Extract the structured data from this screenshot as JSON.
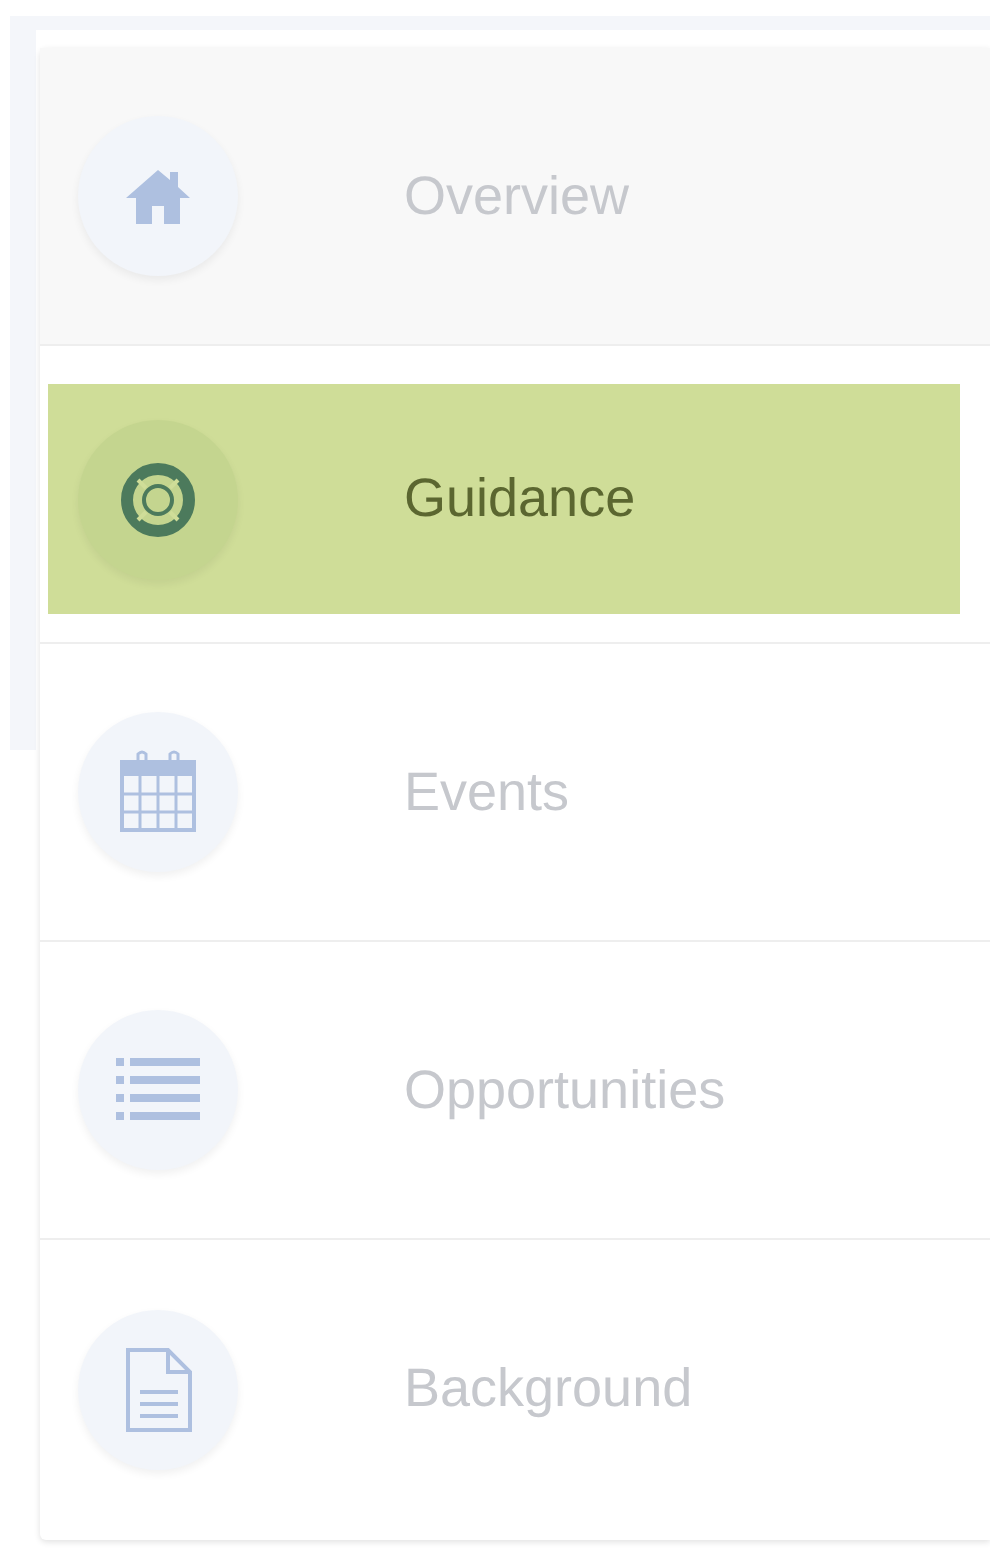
{
  "nav_items": [
    {
      "label": "Overview",
      "selected": false,
      "hovered": true
    },
    {
      "label": "Guidance",
      "selected": true,
      "hovered": false
    },
    {
      "label": "Events",
      "selected": false,
      "hovered": false
    },
    {
      "label": "Opportunities",
      "selected": false,
      "hovered": false
    },
    {
      "label": "Background",
      "selected": false,
      "hovered": false
    }
  ]
}
